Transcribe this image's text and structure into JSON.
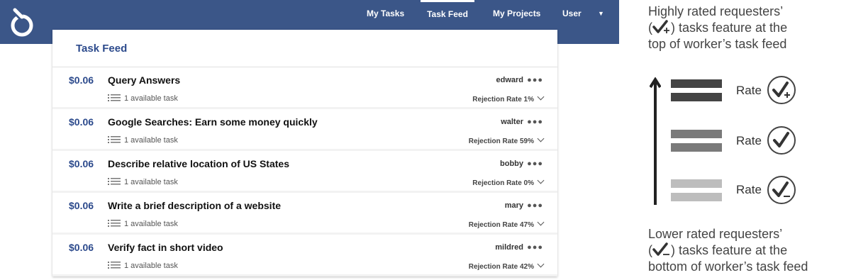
{
  "nav": {
    "items": [
      {
        "label": "My Tasks",
        "active": false
      },
      {
        "label": "Task Feed",
        "active": true
      },
      {
        "label": "My Projects",
        "active": false
      },
      {
        "label": "User",
        "active": false
      }
    ],
    "caret_icon": "caret-down-icon",
    "logo_icon": "logo-icon"
  },
  "panel": {
    "title": "Task Feed",
    "rows": [
      {
        "price": "$0.06",
        "title": "Query Answers",
        "available": "1 available task",
        "requester": "edward",
        "rejection": "Rejection Rate 1%"
      },
      {
        "price": "$0.06",
        "title": "Google Searches: Earn some money quickly",
        "available": "1 available task",
        "requester": "walter",
        "rejection": "Rejection Rate 59%"
      },
      {
        "price": "$0.06",
        "title": "Describe relative location of US States",
        "available": "1 available task",
        "requester": "bobby",
        "rejection": "Rejection Rate 0%"
      },
      {
        "price": "$0.06",
        "title": "Write a brief description of a website",
        "available": "1 available task",
        "requester": "mary",
        "rejection": "Rejection Rate 47%"
      },
      {
        "price": "$0.06",
        "title": "Verify fact in short video",
        "available": "1 available task",
        "requester": "mildred",
        "rejection": "Rejection Rate 42%"
      }
    ],
    "dots": "●●●"
  },
  "annotation": {
    "top_text_line1": "Highly rated requesters’",
    "top_text_line2_pre": "(",
    "top_text_line2_post": ") tasks feature at the",
    "top_text_line3": "top of worker’s task feed",
    "bottom_text_line1": "Lower rated requesters’",
    "bottom_text_line2_pre": "(",
    "bottom_text_line2_post": ") tasks feature at the",
    "bottom_text_line3": "bottom of worker’s task feed",
    "rate_labels": [
      "Rate",
      "Rate",
      "Rate"
    ],
    "bar_colors": [
      "#444444",
      "#7a7a7a",
      "#bdbdbd"
    ],
    "rate_icons": [
      "check-plus-icon",
      "check-icon",
      "check-minus-icon"
    ]
  },
  "colors": {
    "navbar": "#3b5688",
    "accent": "#2c4a8c"
  }
}
